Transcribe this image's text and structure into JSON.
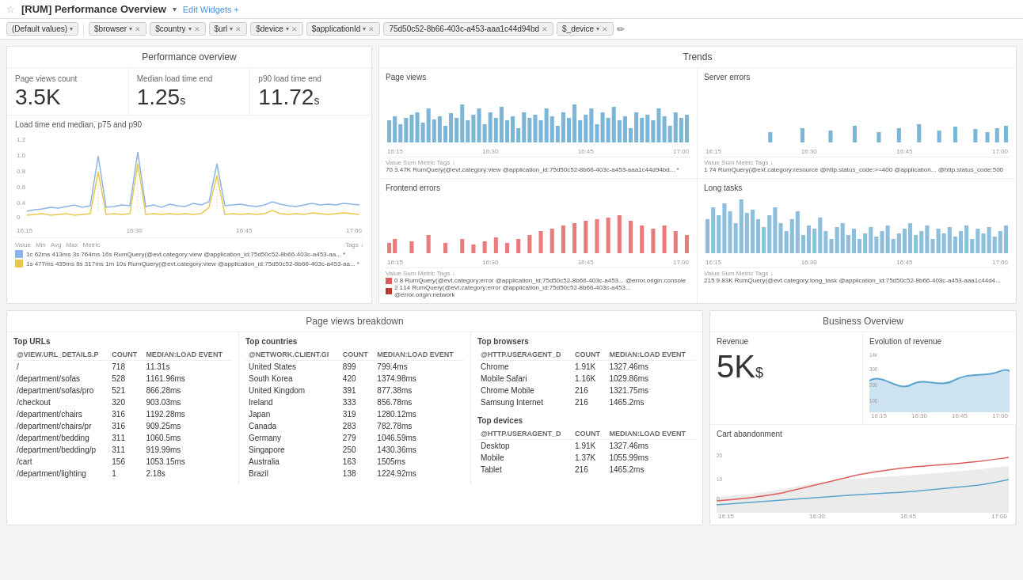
{
  "topbar": {
    "title": "[RUM] Performance Overview",
    "edit_widgets_label": "Edit Widgets +",
    "breadcrumb_tag": "⭐"
  },
  "filters": [
    {
      "label": "(Default values)",
      "type": "default"
    },
    {
      "label": "$browser",
      "type": "tag"
    },
    {
      "label": "$country",
      "type": "tag"
    },
    {
      "label": "$url",
      "type": "tag"
    },
    {
      "label": "$device",
      "type": "tag"
    },
    {
      "label": "$applicationId",
      "type": "tag"
    },
    {
      "label": "75d50c52-8b66-403c-a453-aaa1c44d94bd",
      "type": "value"
    },
    {
      "label": "$_device",
      "type": "tag"
    }
  ],
  "performance_overview": {
    "title": "Performance overview",
    "metrics": [
      {
        "label": "Page views count",
        "value": "3.5K",
        "unit": ""
      },
      {
        "label": "Median load time end",
        "value": "1.25",
        "unit": "s"
      },
      {
        "label": "p90 load time end",
        "value": "11.72",
        "unit": "s"
      }
    ],
    "load_chart_title": "Load time end median, p75 and p90",
    "legend": [
      {
        "color": "#8ab4e8",
        "label": "1c 62ms  413ms  3s 764ms  16s  RumQuery(@evt.category:view @application_id:75d50c52-8b66-403c-a453-aa...  *"
      },
      {
        "color": "#e8c84a",
        "label": "1s 477ms  435ms  8s 317ms  1m 10s  RumQuery(@evt.category:view @application_id:75d50c52-8b66-403c-a453-aa...  *"
      }
    ],
    "x_labels": [
      "16:15",
      "16:30",
      "16:45",
      "17:00"
    ]
  },
  "trends": {
    "title": "Trends",
    "page_views": {
      "title": "Page views",
      "legend_value": "70",
      "legend_sum": "3.47K",
      "legend_metric": "RumQuery(@evt.category:view @application_id:75d50c52-8b66-403c-a453-aaa1c44d94bd...",
      "x_labels": [
        "16:15",
        "16:30",
        "16:45",
        "17:00"
      ]
    },
    "server_errors": {
      "title": "Server errors",
      "legend_value": "1",
      "legend_sum": "74",
      "legend_metric": "RumQuery(@ext.category:resource @http.status_code:>=400 @application...  @http.status_code:500",
      "x_labels": [
        "16:15",
        "16:30",
        "16:45",
        "17:00"
      ]
    },
    "frontend_errors": {
      "title": "Frontend errors",
      "legend_value": "0",
      "legend_value2": "2",
      "legend_sum": "8",
      "legend_sum2": "114",
      "x_labels": [
        "16:15",
        "16:30",
        "16:45",
        "17:00"
      ]
    },
    "long_tasks": {
      "title": "Long tasks",
      "legend_value": "215",
      "legend_sum": "9.83K",
      "x_labels": [
        "16:15",
        "16:30",
        "16:45",
        "17:00"
      ]
    }
  },
  "page_views_breakdown": {
    "title": "Page views breakdown",
    "top_urls": {
      "title": "Top URLs",
      "columns": [
        "@VIEW.URL_DETAILS.P",
        "COUNT",
        "MEDIAN:LOAD EVENT"
      ],
      "rows": [
        {
          "/": "",
          "count": "718",
          "median": "11.31s"
        },
        {
          "/department/sofas": "",
          "count": "528",
          "median": "1161.96ms"
        },
        {
          "/department/sofas/pro": "",
          "count": "521",
          "median": "866.28ms"
        },
        {
          "/checkout": "",
          "count": "320",
          "median": "903.03ms"
        },
        {
          "/department/chairs": "",
          "count": "316",
          "median": "1192.28ms"
        },
        {
          "/department/chairs/pr": "",
          "count": "316",
          "median": "909.25ms"
        },
        {
          "/department/bedding": "",
          "count": "311",
          "median": "1060.5ms"
        },
        {
          "/department/bedding/p": "",
          "count": "311",
          "median": "919.99ms"
        },
        {
          "/cart": "",
          "count": "156",
          "median": "1053.15ms"
        },
        {
          "/department/lighting": "",
          "count": "1",
          "median": "2.18s"
        }
      ]
    },
    "top_countries": {
      "title": "Top countries",
      "columns": [
        "@NETWORK.CLIENT.GI",
        "COUNT",
        "MEDIAN:LOAD EVENT"
      ],
      "rows": [
        {
          "country": "United States",
          "count": "899",
          "median": "799.4ms"
        },
        {
          "country": "South Korea",
          "count": "420",
          "median": "1374.98ms"
        },
        {
          "country": "United Kingdom",
          "count": "391",
          "median": "877.38ms"
        },
        {
          "country": "Ireland",
          "count": "333",
          "median": "856.78ms"
        },
        {
          "country": "Japan",
          "count": "319",
          "median": "1280.12ms"
        },
        {
          "country": "Canada",
          "count": "283",
          "median": "782.78ms"
        },
        {
          "country": "Germany",
          "count": "279",
          "median": "1046.59ms"
        },
        {
          "country": "Singapore",
          "count": "250",
          "median": "1430.36ms"
        },
        {
          "country": "Australia",
          "count": "163",
          "median": "1505ms"
        },
        {
          "country": "Brazil",
          "count": "138",
          "median": "1224.92ms"
        }
      ]
    },
    "top_browsers": {
      "title": "Top browsers",
      "columns": [
        "@HTTP.USERAGENT_D",
        "COUNT",
        "MEDIAN:LOAD EVENT"
      ],
      "rows": [
        {
          "browser": "Chrome",
          "count": "1.91K",
          "median": "1327.46ms"
        },
        {
          "browser": "Mobile Safari",
          "count": "1.16K",
          "median": "1029.86ms"
        },
        {
          "browser": "Chrome Mobile",
          "count": "216",
          "median": "1321.75ms"
        },
        {
          "browser": "Samsung Internet",
          "count": "216",
          "median": "1465.2ms"
        }
      ]
    },
    "top_devices": {
      "title": "Top devices",
      "columns": [
        "@HTTP.USERAGENT_D",
        "COUNT",
        "MEDIAN:LOAD EVENT"
      ],
      "rows": [
        {
          "device": "Desktop",
          "count": "1.91K",
          "median": "1327.46ms"
        },
        {
          "device": "Mobile",
          "count": "1.37K",
          "median": "1055.99ms"
        },
        {
          "device": "Tablet",
          "count": "216",
          "median": "1465.2ms"
        }
      ]
    }
  },
  "business_overview": {
    "title": "Business Overview",
    "revenue": {
      "title": "Revenue",
      "value": "5K",
      "unit": "$"
    },
    "evolution_of_revenue": {
      "title": "Evolution of revenue",
      "x_labels": [
        "16:15",
        "16:30",
        "16:45",
        "17:00"
      ]
    },
    "cart_abandonment": {
      "title": "Cart abandonment",
      "x_labels": [
        "16:15",
        "16:30",
        "16:45",
        "17:00"
      ]
    }
  }
}
